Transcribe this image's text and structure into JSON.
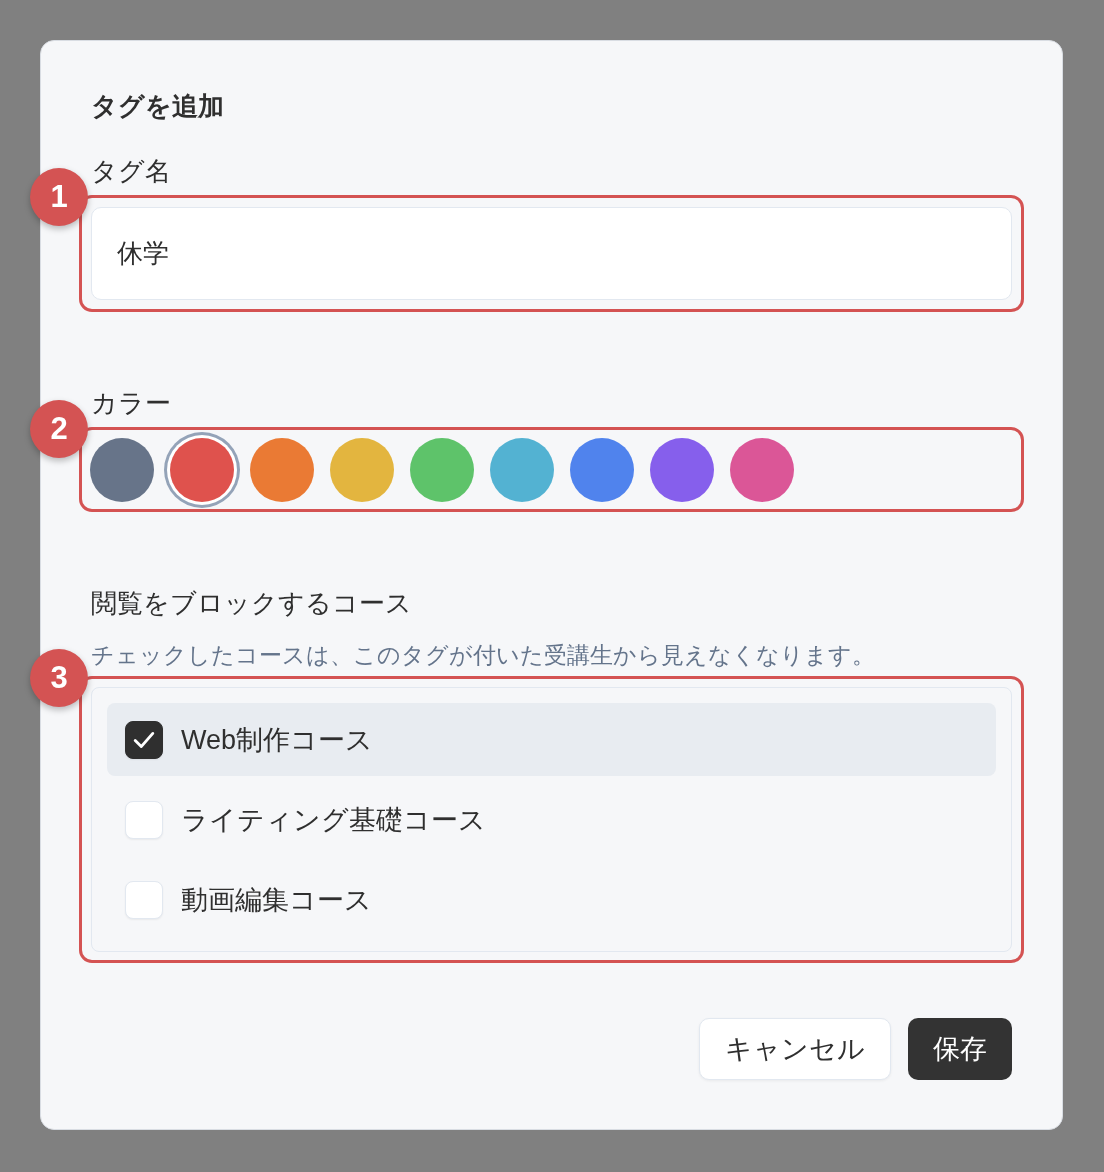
{
  "dialog": {
    "title": "タグを追加",
    "name_field": {
      "label": "タグ名",
      "value": "休学",
      "callout": "1"
    },
    "color_picker": {
      "label": "カラー",
      "callout": "2",
      "swatches": [
        {
          "color": "#677489",
          "selected": false
        },
        {
          "color": "#df524d",
          "selected": true
        },
        {
          "color": "#ea7a34",
          "selected": false
        },
        {
          "color": "#e3b53f",
          "selected": false
        },
        {
          "color": "#5ec36a",
          "selected": false
        },
        {
          "color": "#53b2d2",
          "selected": false
        },
        {
          "color": "#5083ed",
          "selected": false
        },
        {
          "color": "#865fec",
          "selected": false
        },
        {
          "color": "#db5697",
          "selected": false
        }
      ]
    },
    "course_block": {
      "label": "閲覧をブロックするコース",
      "hint": "チェックしたコースは、このタグが付いた受講生から見えなくなります。",
      "callout": "3",
      "courses": [
        {
          "name": "Web制作コース",
          "checked": true,
          "selected": true
        },
        {
          "name": "ライティング基礎コース",
          "checked": false,
          "selected": false
        },
        {
          "name": "動画編集コース",
          "checked": false,
          "selected": false
        }
      ]
    },
    "buttons": [
      {
        "label": "キャンセル",
        "kind": "secondary"
      },
      {
        "label": "保存",
        "kind": "primary"
      }
    ]
  }
}
